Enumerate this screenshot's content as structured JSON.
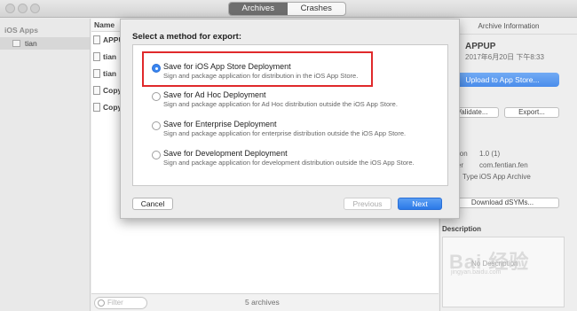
{
  "window": {
    "tabs": [
      "Archives",
      "Crashes"
    ],
    "active_tab": "Archives"
  },
  "sidebar": {
    "heading": "iOS Apps",
    "items": [
      {
        "label": "tian"
      }
    ]
  },
  "list": {
    "column_header": "Name",
    "rows": [
      "APPU",
      "tian",
      "tian",
      "Copy",
      "Copy"
    ],
    "filter_placeholder": "Filter",
    "count": "5 archives"
  },
  "right_panel": {
    "header": "Archive Information",
    "app_name": "APPUP",
    "app_date": "2017年6月20日 下午8:33",
    "upload_button": "Upload to App Store...",
    "validate_button": "Validate...",
    "export_button": "Export...",
    "details_heading": "ils",
    "version_label": "Version",
    "version_value": "1.0 (1)",
    "identifier_label": "entifier",
    "identifier_value": "com.fentian.fen",
    "type_label": "Type",
    "type_value": "iOS App Archive",
    "dsyms_button": "Download dSYMs...",
    "description_heading": "Description",
    "description_empty": "No Description",
    "watermark": "Bai 经验",
    "watermark_sub": "jingyan.baidu.com"
  },
  "sheet": {
    "title": "Select a method for export:",
    "options": [
      {
        "title": "Save for iOS App Store Deployment",
        "desc": "Sign and package application for distribution in the iOS App Store.",
        "selected": true
      },
      {
        "title": "Save for Ad Hoc Deployment",
        "desc": "Sign and package application for Ad Hoc distribution outside the iOS App Store.",
        "selected": false
      },
      {
        "title": "Save for Enterprise Deployment",
        "desc": "Sign and package application for enterprise distribution outside the iOS App Store.",
        "selected": false
      },
      {
        "title": "Save for Development Deployment",
        "desc": "Sign and package application for development distribution outside the iOS App Store.",
        "selected": false
      }
    ],
    "cancel_button": "Cancel",
    "previous_button": "Previous",
    "next_button": "Next"
  },
  "colors": {
    "accent": "#2b79e8",
    "highlight": "#e0292b"
  }
}
